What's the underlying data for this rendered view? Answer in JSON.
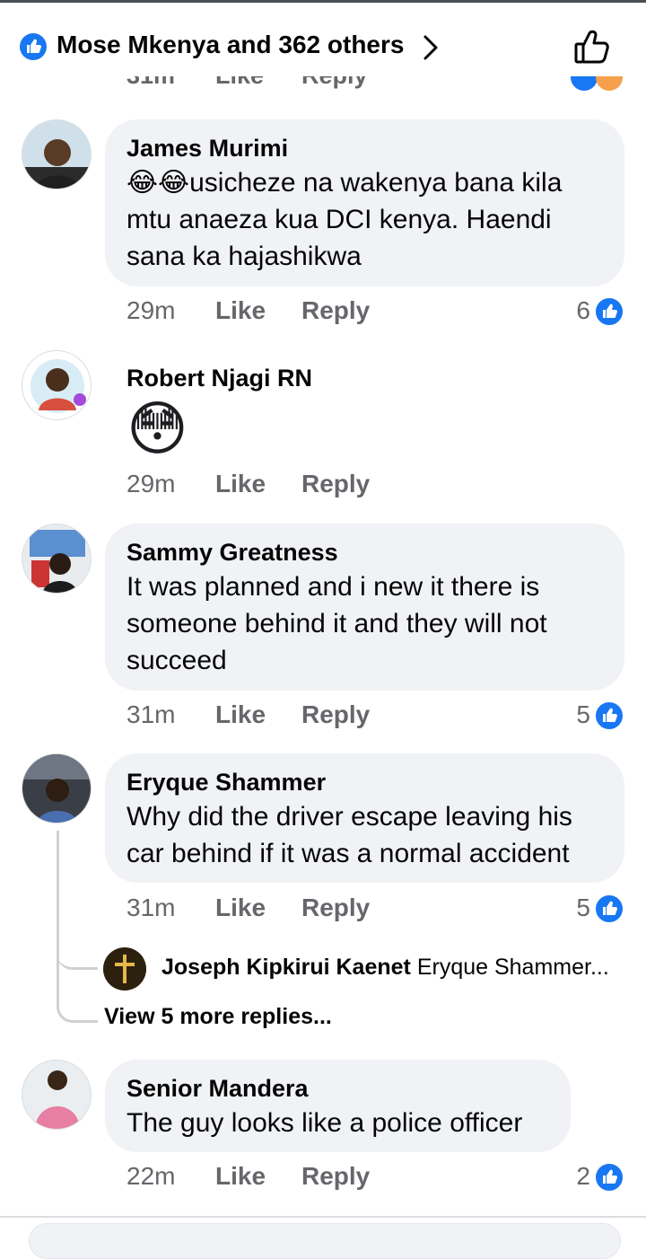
{
  "header": {
    "reactions_summary": "Mose Mkenya and 362 others",
    "like_icon": "thumbs-up-outline-icon",
    "chevron_icon": "chevron-right-icon",
    "accent": "#1877f2"
  },
  "comments": [
    {
      "author": "James Murimi",
      "text": "😂😂usicheze na wakenya bana kila mtu anaeza kua DCI kenya. Haendi sana ka hajashikwa",
      "time": "29m",
      "like_label": "Like",
      "reply_label": "Reply",
      "reaction_count": "6"
    },
    {
      "author": "Robert Njagi RN",
      "text": "😳",
      "time": "29m",
      "like_label": "Like",
      "reply_label": "Reply"
    },
    {
      "author": "Sammy Greatness",
      "text": "It was planned and i new it there is someone behind it and they will not succeed",
      "time": "31m",
      "like_label": "Like",
      "reply_label": "Reply",
      "reaction_count": "5"
    },
    {
      "author": "Eryque Shammer",
      "text": "Why did the driver escape leaving his car behind if it was a normal accident",
      "time": "31m",
      "like_label": "Like",
      "reply_label": "Reply",
      "reaction_count": "5",
      "reply_preview": {
        "author": "Joseph Kipkirui Kaenet",
        "text": "Eryque Shammer..."
      },
      "view_more": "View 5 more replies..."
    },
    {
      "author": "Senior Mandera",
      "text": "The guy looks like a police officer",
      "time": "22m",
      "like_label": "Like",
      "reply_label": "Reply",
      "reaction_count": "2"
    }
  ]
}
